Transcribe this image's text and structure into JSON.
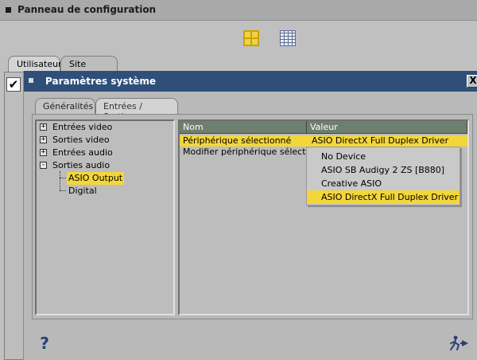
{
  "outer": {
    "title": "Panneau de configuration",
    "tabs": [
      {
        "label": "Utilisateur"
      },
      {
        "label": "Site"
      }
    ]
  },
  "view_icons": [
    "grid-view-icon",
    "list-view-icon"
  ],
  "dialog": {
    "title": "Paramètres système",
    "close_label": "X",
    "tabs": [
      {
        "label": "Généralités"
      },
      {
        "label": "Entrées / Sorties"
      }
    ],
    "tree": {
      "items": [
        {
          "label": "Entrées video",
          "expander": "+"
        },
        {
          "label": "Sorties video",
          "expander": "+"
        },
        {
          "label": "Entrées audio",
          "expander": "+"
        },
        {
          "label": "Sorties audio",
          "expander": "-"
        }
      ],
      "children": [
        {
          "label": "ASIO Output",
          "selected": true
        },
        {
          "label": "Digital",
          "selected": false
        }
      ]
    },
    "grid": {
      "columns": [
        "Nom",
        "Valeur"
      ],
      "rows": [
        {
          "name": "Périphérique sélectionné",
          "value": "ASIO DirectX Full Duplex Driver",
          "selected": true
        },
        {
          "name": "Modifier périphérique sélection...",
          "value": ""
        }
      ]
    },
    "dropdown": {
      "options": [
        "No Device",
        "ASIO SB Audigy 2 ZS [B880]",
        "Creative ASIO",
        "ASIO DirectX Full Duplex Driver"
      ],
      "selected": "ASIO DirectX Full Duplex Driver"
    }
  },
  "footer": {
    "help_glyph": "?",
    "icons": [
      "help-icon",
      "run-exit-icon"
    ]
  },
  "colors": {
    "highlight": "#f3d63a",
    "dialog_titlebar": "#2f4f79",
    "column_header": "#6f7f6d"
  }
}
